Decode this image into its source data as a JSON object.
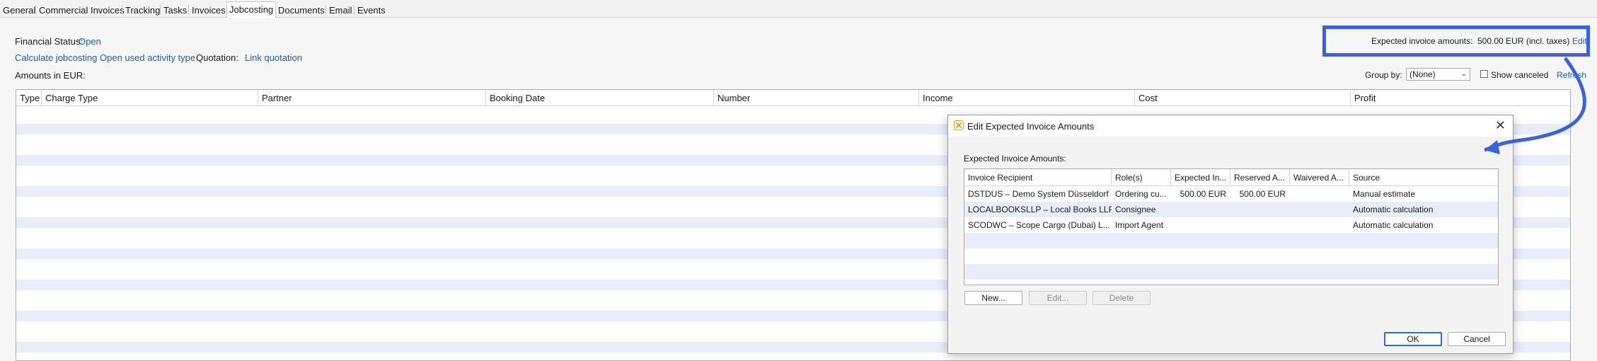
{
  "tabs": [
    {
      "label": "General",
      "active": false
    },
    {
      "label": "Commercial Invoices",
      "active": false
    },
    {
      "label": "Tracking",
      "active": false
    },
    {
      "label": "Tasks",
      "active": false
    },
    {
      "label": "Invoices",
      "active": false
    },
    {
      "label": "Jobcosting",
      "active": true
    },
    {
      "label": "Documents",
      "active": false
    },
    {
      "label": "Email",
      "active": false
    },
    {
      "label": "Events",
      "active": false
    }
  ],
  "financial": {
    "status_label": "Financial Status:",
    "status_value": "Open",
    "calculate_link": "Calculate jobcosting",
    "activity_link": "Open used activity type",
    "quotation_label": "Quotation:",
    "quotation_link": "Link quotation",
    "amounts_label": "Amounts in EUR:"
  },
  "expected": {
    "label": "Expected invoice amounts:",
    "value": "500.00 EUR",
    "taxes": "(incl. taxes)",
    "edit_link": "Edit"
  },
  "toolbar": {
    "group_by_label": "Group by:",
    "group_by_value": "(None)",
    "show_canceled_label": "Show canceled",
    "refresh_link": "Refresh"
  },
  "table": {
    "columns": [
      "Type",
      "Charge Type",
      "Partner",
      "Booking Date",
      "Number",
      "Income",
      "Cost",
      "Profit"
    ]
  },
  "dialog": {
    "title": "Edit Expected Invoice Amounts",
    "section_label": "Expected Invoice Amounts:",
    "columns": [
      "Invoice Recipient",
      "Role(s)",
      "Expected In...",
      "Reserved A...",
      "Waivered A...",
      "Source"
    ],
    "rows": [
      {
        "recipient": "DSTDUS – Demo System Düsseldorf",
        "roles": "Ordering cu...",
        "expected": "500.00 EUR",
        "reserved": "500.00 EUR",
        "waivered": "",
        "source": "Manual estimate"
      },
      {
        "recipient": "LOCALBOOKSLLP – Local Books LLP",
        "roles": "Consignee",
        "expected": "",
        "reserved": "",
        "waivered": "",
        "source": "Automatic calculation"
      },
      {
        "recipient": "SCODWC – Scope Cargo (Dubai) L...",
        "roles": "Import Agent",
        "expected": "",
        "reserved": "",
        "waivered": "",
        "source": "Automatic calculation"
      }
    ],
    "new_button": "New...",
    "edit_button": "Edit...",
    "delete_button": "Delete",
    "ok_button": "OK",
    "cancel_button": "Cancel"
  },
  "colors": {
    "link": "#1a5fb4",
    "highlight": "#3b63d9",
    "stripe": "#e8eef8",
    "default_button": "#2a6fd6"
  },
  "icons": {
    "dialog_icon": "app-logo-icon",
    "close": "close-icon",
    "dropdown": "chevron-down-icon"
  }
}
